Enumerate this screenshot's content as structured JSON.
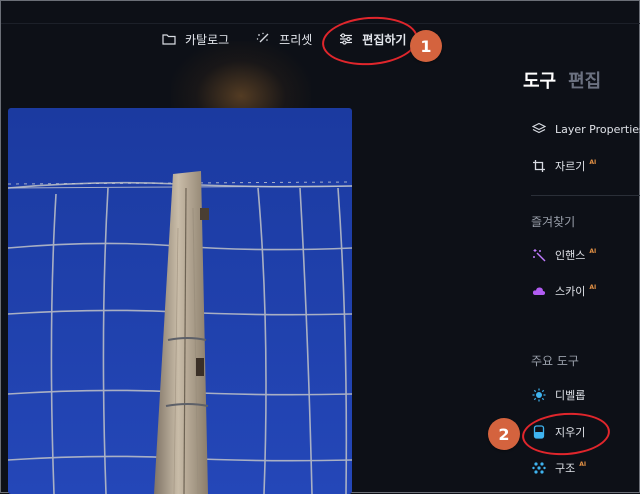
{
  "topnav": {
    "catalog": "카탈로그",
    "presets": "프리셋",
    "edit": "편집하기"
  },
  "panel": {
    "tabs": [
      "도구",
      "편집"
    ],
    "items": {
      "layer_properties": "Layer Properties",
      "crop": "자르기"
    },
    "favorites": {
      "title": "즐겨찾기",
      "items": [
        "인핸스",
        "스카이"
      ]
    },
    "main_tools": {
      "title": "주요 도구",
      "items": [
        "디벨롭",
        "지우기",
        "구조"
      ]
    },
    "ai_label": "AI"
  },
  "annotations": {
    "badge1": "1",
    "badge2": "2"
  },
  "colors": {
    "background": "#0d1017",
    "annotation_ring": "#e0262c",
    "badge": "#d4633e",
    "ai_tag": "#e39145",
    "sky": "#1d3fa8"
  },
  "icons": {
    "catalog": "folder-icon",
    "presets": "magic-wand-icon",
    "edit": "sliders-icon",
    "layer_properties": "layers-icon",
    "crop": "crop-icon",
    "enhance": "sparkle-icon",
    "sky": "cloud-icon",
    "develop": "sun-icon",
    "erase": "eraser-icon",
    "structure": "structure-icon"
  }
}
